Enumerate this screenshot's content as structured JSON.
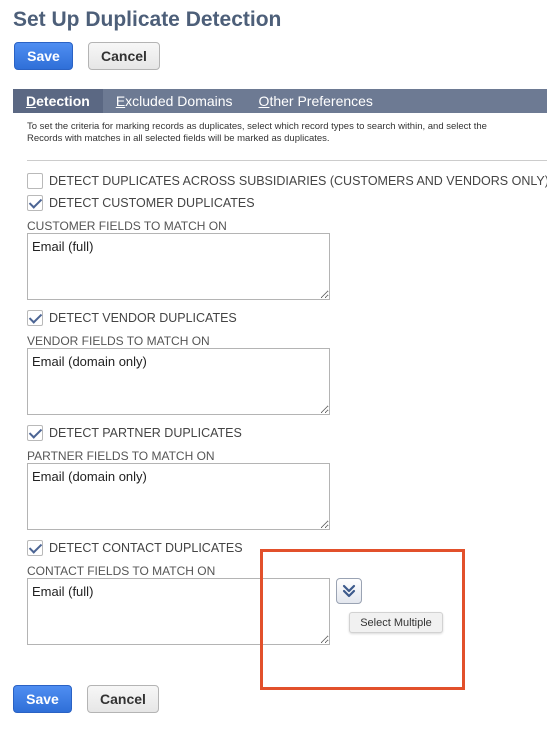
{
  "page": {
    "title": "Set Up Duplicate Detection"
  },
  "buttons": {
    "save": "Save",
    "cancel": "Cancel"
  },
  "tabs": [
    {
      "key": "D",
      "rest": "etection"
    },
    {
      "key": "E",
      "rest": "xcluded Domains"
    },
    {
      "key": "O",
      "rest": "ther Preferences"
    }
  ],
  "instructions": {
    "line1": "To set the criteria for marking records as duplicates, select which record types to search within, and select the",
    "line2": "Records with matches in all selected fields will be marked as duplicates."
  },
  "options": {
    "subsidiaries": {
      "label": "DETECT DUPLICATES ACROSS SUBSIDIARIES (CUSTOMERS AND VENDORS ONLY)",
      "checked": false
    },
    "customer": {
      "label": "DETECT CUSTOMER DUPLICATES",
      "checked": true,
      "fields_label": "CUSTOMER FIELDS TO MATCH ON",
      "fields_value": "Email (full)"
    },
    "vendor": {
      "label": "DETECT VENDOR DUPLICATES",
      "checked": true,
      "fields_label": "VENDOR FIELDS TO MATCH ON",
      "fields_value": "Email (domain only)"
    },
    "partner": {
      "label": "DETECT PARTNER DUPLICATES",
      "checked": true,
      "fields_label": "PARTNER FIELDS TO MATCH ON",
      "fields_value": "Email (domain only)"
    },
    "contact": {
      "label": "DETECT CONTACT DUPLICATES",
      "checked": true,
      "fields_label": "CONTACT FIELDS TO MATCH ON",
      "fields_value": "Email (full)"
    }
  },
  "tooltip": {
    "text": "Select Multiple"
  },
  "colors": {
    "title": "#4d5f79",
    "primary": "#2f6fd8",
    "tabbar": "#6d7a93",
    "highlight": "#e2502b"
  },
  "icons": {
    "picker": "double-chevron-down-icon"
  }
}
